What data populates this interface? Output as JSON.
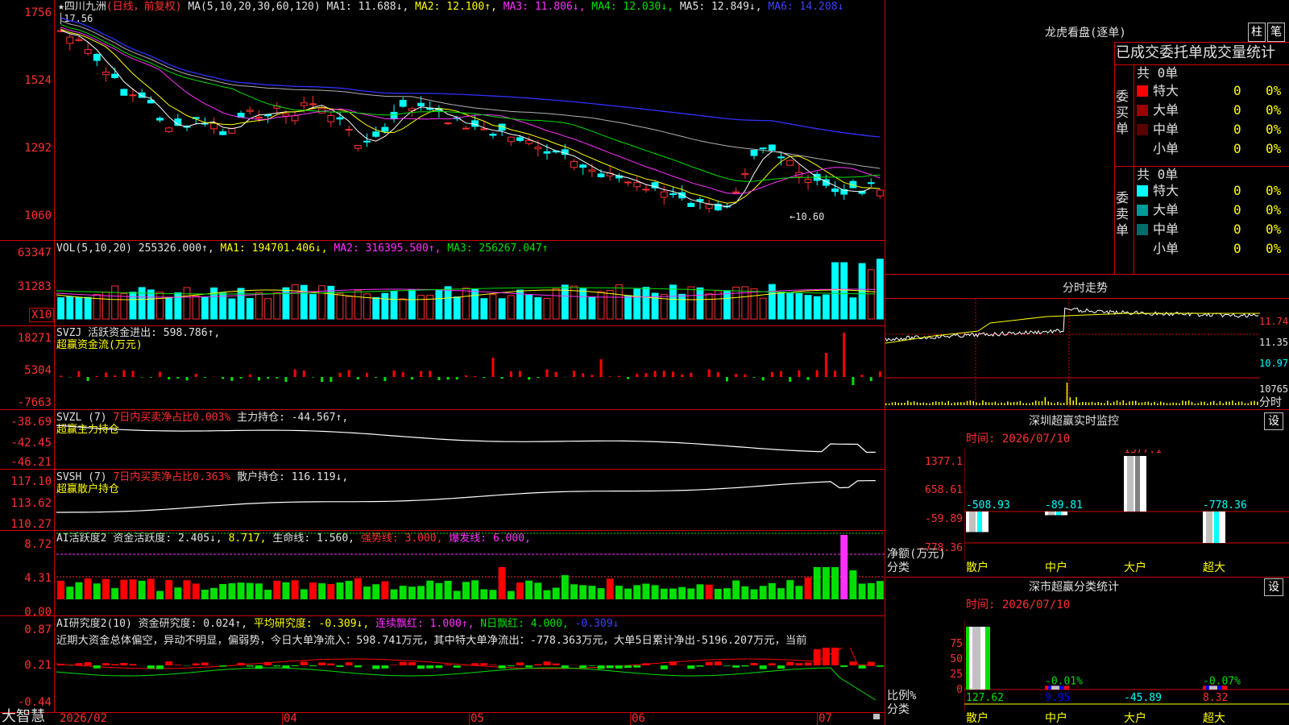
{
  "main": {
    "y_ticks": [
      "1756",
      "1524",
      "1292",
      "1060"
    ],
    "title_star": "★",
    "stock_name": "四川九洲",
    "period": "(日线，前复权)",
    "ma_label": "MA(5,10,20,30,60,120)",
    "ma1": "MA1: 11.688↓,",
    "ma2": "MA2: 12.100↑,",
    "ma3": "MA3: 11.806↓,",
    "ma4": "MA4: 12.030↓,",
    "ma5": "MA5: 12.849↓,",
    "ma6": "MA6: 14.208↓",
    "high_mark": "17.56",
    "low_mark": "←10.60"
  },
  "vol": {
    "y_ticks": [
      "63347",
      "31283"
    ],
    "unit": "X10",
    "label": "VOL(5,10,20)",
    "value": "255326.000↑,",
    "ma1": "MA1: 194701.406↓,",
    "ma2": "MA2: 316395.500↑,",
    "ma3": "MA3: 256267.047↑"
  },
  "svzj": {
    "y_ticks": [
      "18271",
      "5304",
      "-7663"
    ],
    "line1_prefix": "SVZJ",
    "line1_value": "活跃资金进出: 598.786↑,",
    "line2": "超赢资金流(万元)"
  },
  "svzl": {
    "y_ticks": [
      "-38.69",
      "-42.45",
      "-46.21"
    ],
    "line1_prefix": "SVZL (7)",
    "line1_red": "7日内买卖净占比0.003%",
    "line1_value": "主力持仓: -44.567↑,",
    "line2": "超赢主力持仓"
  },
  "svsh": {
    "y_ticks": [
      "117.10",
      "113.62",
      "110.27"
    ],
    "line1_prefix": "SVSH (7)",
    "line1_red": "7日内买卖净占比0.363%",
    "line1_value": "散户持仓: 116.119↓,",
    "line2": "超赢散户持仓"
  },
  "ai_active": {
    "y_ticks": [
      "8.72",
      "4.31",
      "0.00"
    ],
    "label": "AI活跃度2",
    "v1": "资金活跃度: 2.405↓,",
    "v2": "8.717,",
    "v3": "生命线: 1.560,",
    "v4": "强势线: 3.000,",
    "v5": "爆发线: 6.000,"
  },
  "ai_research": {
    "y_ticks": [
      "0.87",
      "0.21",
      "-0.44"
    ],
    "label": "AI研究度2(10)",
    "v1": "资金研究度: 0.024↑,",
    "v2": "平均研究度: -0.309↓,",
    "v3": "连续飘红: 1.000↑,",
    "v4": "N日飘红: 4.000,",
    "v5": "-0.309↓",
    "summary": "近期大资金总体偏空，异动不明显，偏弱势，今日大单净流入：598.741万元，其中特大单净流出：-778.363万元，大单5日累计净出-5196.207万元，当前"
  },
  "bottom": {
    "brand": "大智慧",
    "dates": [
      "2026/02",
      "04",
      "05",
      "06",
      "07"
    ]
  },
  "right": {
    "title": "龙虎看盘(逐单)",
    "btn1": "柱",
    "btn2": "笔",
    "tabs_header": "已成交委托单成交量统计",
    "buy": {
      "side": "委买单",
      "total": "共 0单",
      "rows": [
        {
          "name": "特大",
          "val": "0",
          "pct": "0%",
          "color": "#ff0000"
        },
        {
          "name": "大单",
          "val": "0",
          "pct": "0%",
          "color": "#9a0000"
        },
        {
          "name": "中单",
          "val": "0",
          "pct": "0%",
          "color": "#5a0000"
        },
        {
          "name": "小单",
          "val": "0",
          "pct": "0%",
          "color": ""
        }
      ]
    },
    "sell": {
      "side": "委卖单",
      "total": "共 0单",
      "rows": [
        {
          "name": "特大",
          "val": "0",
          "pct": "0%",
          "color": "#00ffff"
        },
        {
          "name": "大单",
          "val": "0",
          "pct": "0%",
          "color": "#009999"
        },
        {
          "name": "中单",
          "val": "0",
          "pct": "0%",
          "color": "#006b6b"
        },
        {
          "name": "小单",
          "val": "0",
          "pct": "0%",
          "color": ""
        }
      ]
    },
    "intraday": {
      "title": "分时走势",
      "y_ticks": [
        "11.74",
        "11.35",
        "10.97",
        "10765"
      ],
      "foot": "分时"
    },
    "sz_monitor": {
      "title": "深圳超赢实时监控",
      "btn": "设",
      "time": "时间: 2026/07/10",
      "y_ticks": [
        "1377.1",
        "658.61",
        "-59.89",
        "-778.36"
      ],
      "unit1": "净额(万元)",
      "unit2": "分类",
      "categories": [
        "散户",
        "中户",
        "大户",
        "超大"
      ],
      "values": [
        -508.93,
        -89.81,
        1377.1,
        -778.36
      ],
      "value_labels": [
        "-508.93",
        "-89.81",
        "1377.1",
        "-778.36"
      ]
    },
    "sz_class": {
      "title": "深市超赢分类统计",
      "btn": "设",
      "time": "时间: 2026/07/10",
      "y_ticks": [
        "75",
        "50",
        "25",
        "0"
      ],
      "unit1": "比例%",
      "unit2": "分类",
      "categories": [
        "散户",
        "中户",
        "大户",
        "超大"
      ],
      "top_labels": [
        "",
        "-0.01%",
        "",
        "-0.07%"
      ],
      "bottom_labels": [
        "127.62",
        "9.95",
        "-45.89",
        "8.32"
      ],
      "ratios": [
        100,
        6,
        0,
        6
      ]
    }
  },
  "colors": {
    "up": "#ff3030",
    "down": "#00ffff",
    "grid": "#d00000",
    "ma1": "#ffffff",
    "ma2": "#ffff00",
    "ma3": "#ff30ff",
    "ma4": "#00e000",
    "ma5": "#c0c0c0",
    "ma6": "#4040ff"
  }
}
